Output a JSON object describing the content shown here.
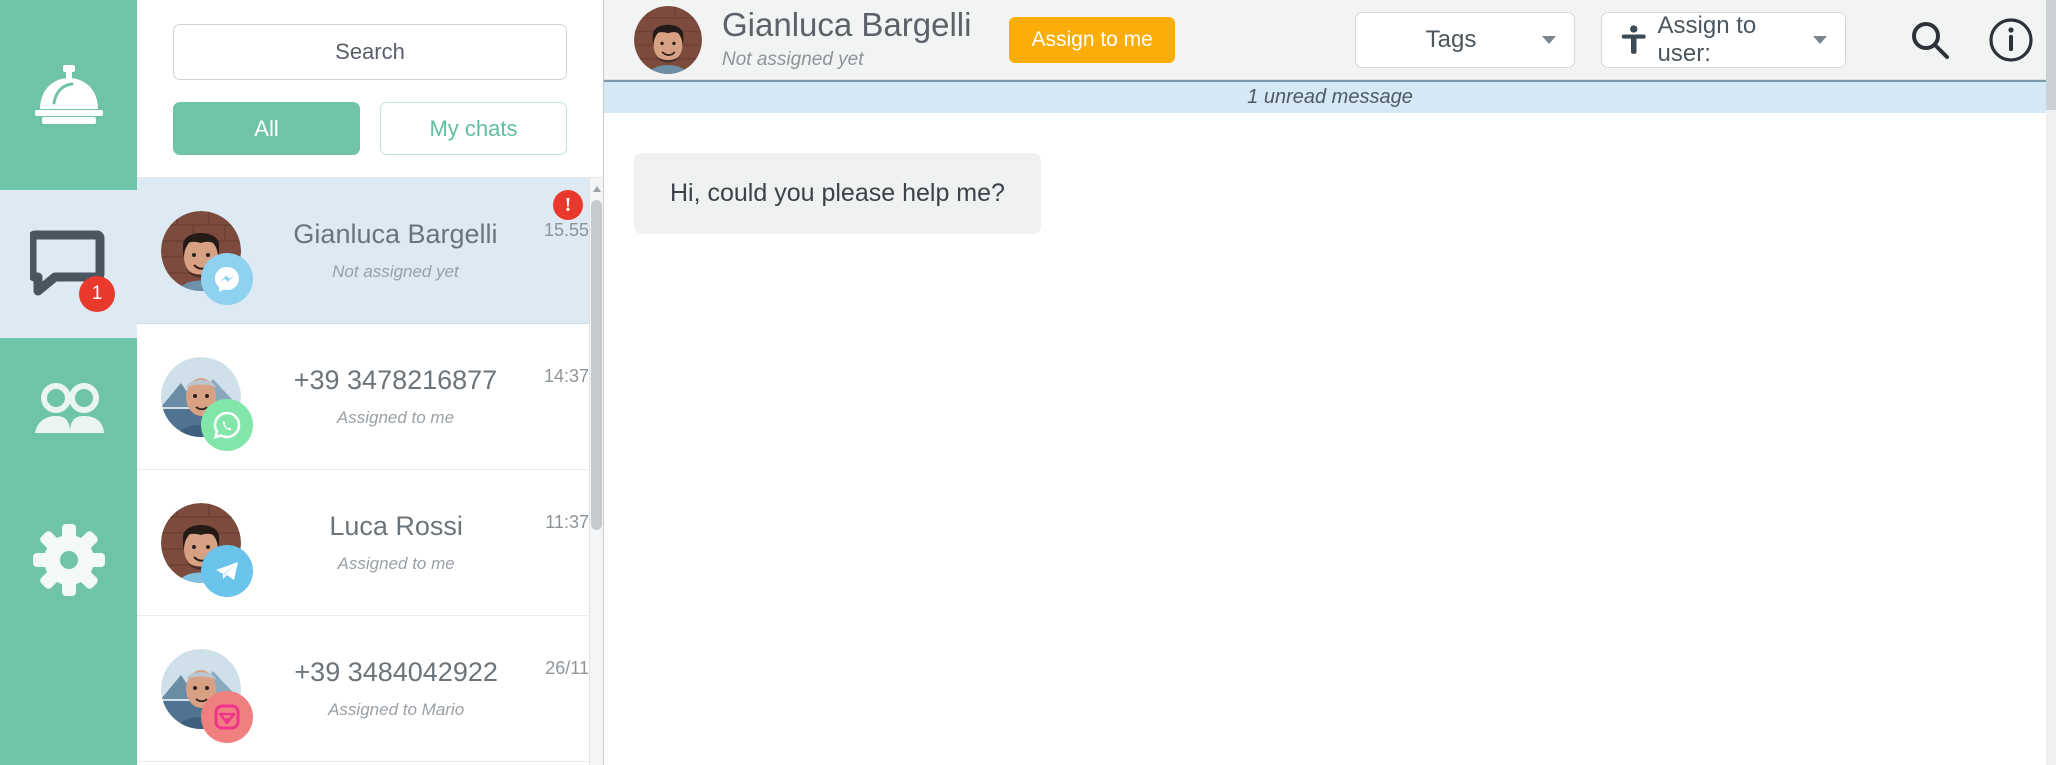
{
  "rail": {
    "logo_icon": "service-bell-icon",
    "items": [
      {
        "icon": "chat-bubble-icon",
        "name": "chats",
        "active": true,
        "badge": "1"
      },
      {
        "icon": "users-icon",
        "name": "contacts",
        "active": false,
        "badge": ""
      },
      {
        "icon": "gear-icon",
        "name": "settings",
        "active": false,
        "badge": ""
      }
    ],
    "bg_color": "#6ec3a8",
    "active_bg_color": "#ddeaf3",
    "badge_color": "#e8392c"
  },
  "list": {
    "search": {
      "value": "",
      "placeholder": "Search"
    },
    "filters": [
      {
        "label": "All",
        "selected": true
      },
      {
        "label": "My chats",
        "selected": false
      }
    ],
    "accent_color": "#6ec3a8",
    "conversations": [
      {
        "name": "Gianluca Bargelli",
        "status": "Not assigned yet",
        "time": "15.55",
        "channel": "messenger",
        "channel_color": "#8ed2f0",
        "selected": true,
        "alert": "!"
      },
      {
        "name": "+39 3478216877",
        "status": "Assigned to me",
        "time": "14:37",
        "channel": "whatsapp",
        "channel_color": "#82e6ab",
        "selected": false,
        "alert": ""
      },
      {
        "name": "Luca Rossi",
        "status": "Assigned to me",
        "time": "11:37",
        "channel": "telegram",
        "channel_color": "#69c3ea",
        "selected": false,
        "alert": ""
      },
      {
        "name": "+39 3484042922",
        "status": "Assigned to Mario",
        "time": "26/11",
        "channel": "instagram",
        "channel_color": "#f08080",
        "selected": false,
        "alert": ""
      }
    ]
  },
  "chat": {
    "contact_name": "Gianluca Bargelli",
    "contact_status": "Not assigned yet",
    "assign_me_label": "Assign to me",
    "assign_me_color": "#fcad07",
    "tags_label": "Tags",
    "assign_user_label": "Assign to user:",
    "search_icon": "search-icon",
    "info_icon": "info-icon",
    "unread_banner": "1 unread message",
    "unread_banner_color": "#d5e8f5",
    "messages": [
      {
        "text": "Hi, could you please help me?",
        "from": "contact"
      }
    ]
  }
}
